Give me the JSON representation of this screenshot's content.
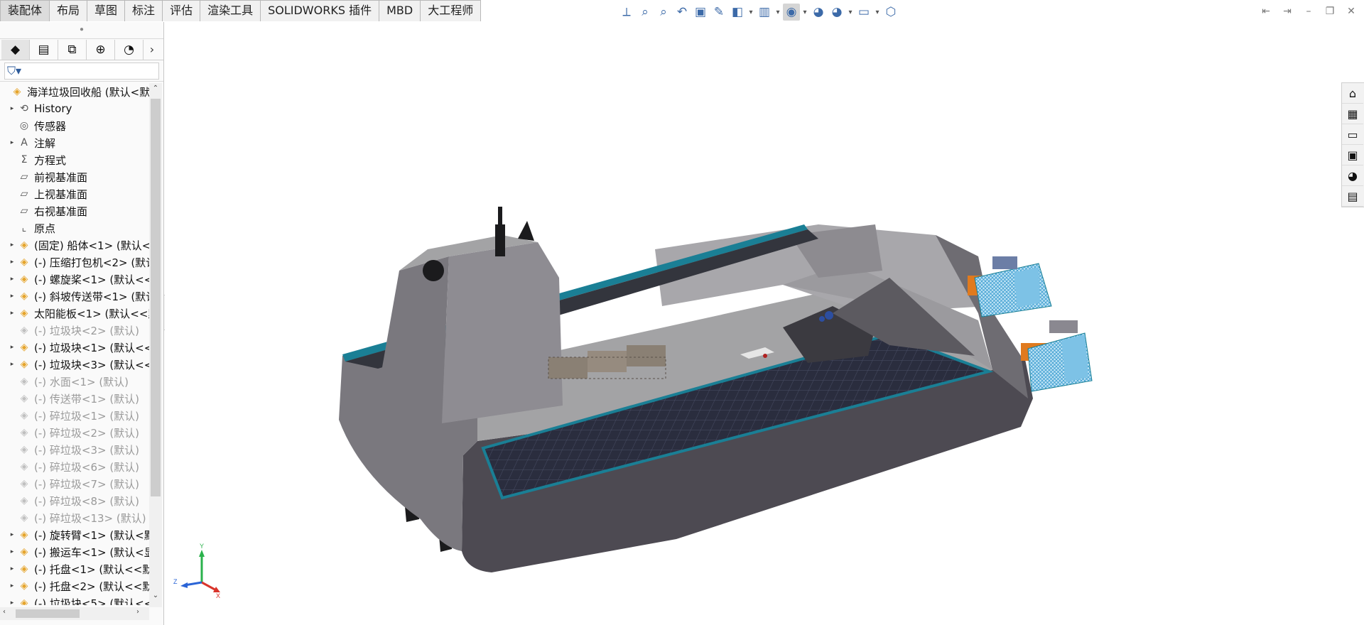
{
  "tabs": [
    {
      "label": "装配体",
      "active": true
    },
    {
      "label": "布局"
    },
    {
      "label": "草图"
    },
    {
      "label": "标注"
    },
    {
      "label": "评估"
    },
    {
      "label": "渲染工具"
    },
    {
      "label": "SOLIDWORKS 插件"
    },
    {
      "label": "MBD"
    },
    {
      "label": "大工程师"
    }
  ],
  "heads_up_toolbar": [
    {
      "icon": "view-orientation-icon",
      "glyph": "⟂"
    },
    {
      "icon": "zoom-to-fit-icon",
      "glyph": "⌕"
    },
    {
      "icon": "zoom-to-area-icon",
      "glyph": "⌕"
    },
    {
      "icon": "previous-view-icon",
      "glyph": "↶"
    },
    {
      "icon": "section-view-icon",
      "glyph": "▣"
    },
    {
      "icon": "dynamic-annotation-icon",
      "glyph": "✎"
    },
    {
      "icon": "display-style-icon",
      "glyph": "◧",
      "caret": true
    },
    {
      "icon": "view-cube-icon",
      "glyph": "▥",
      "caret": true
    },
    {
      "icon": "hide-show-icon",
      "glyph": "◉",
      "active": true,
      "caret": true
    },
    {
      "icon": "edit-appearance-icon",
      "glyph": "◕"
    },
    {
      "icon": "apply-scene-icon",
      "glyph": "◕",
      "caret": true
    },
    {
      "icon": "view-settings-icon",
      "glyph": "▭",
      "caret": true
    },
    {
      "icon": "isometric-cube-icon",
      "glyph": "⬡"
    }
  ],
  "panel_tabs": [
    {
      "icon": "featuremanager-icon",
      "glyph": "◆",
      "active": true
    },
    {
      "icon": "propertymanager-icon",
      "glyph": "▤"
    },
    {
      "icon": "configurationmanager-icon",
      "glyph": "⧉"
    },
    {
      "icon": "dimxpertmanager-icon",
      "glyph": "⊕"
    },
    {
      "icon": "displaymanager-icon",
      "glyph": "◔"
    }
  ],
  "tree": [
    {
      "label": "海洋垃圾回收船 (默认<默认",
      "icon": "assembly-icon",
      "glyph": "◈",
      "type": "root",
      "expander": ""
    },
    {
      "label": "History",
      "icon": "history-icon",
      "glyph": "⟲",
      "type": "folder",
      "expander": "▸"
    },
    {
      "label": "传感器",
      "icon": "sensor-icon",
      "glyph": "◎",
      "type": "folder",
      "expander": ""
    },
    {
      "label": "注解",
      "icon": "annotation-icon",
      "glyph": "A",
      "type": "folder",
      "expander": "▸"
    },
    {
      "label": "方程式",
      "icon": "equation-icon",
      "glyph": "Σ",
      "type": "folder",
      "expander": ""
    },
    {
      "label": "前视基准面",
      "icon": "plane-icon",
      "glyph": "▱",
      "type": "folder",
      "expander": ""
    },
    {
      "label": "上视基准面",
      "icon": "plane-icon",
      "glyph": "▱",
      "type": "folder",
      "expander": ""
    },
    {
      "label": "右视基准面",
      "icon": "plane-icon",
      "glyph": "▱",
      "type": "folder",
      "expander": ""
    },
    {
      "label": "原点",
      "icon": "origin-icon",
      "glyph": "⌞",
      "type": "folder",
      "expander": ""
    },
    {
      "label": "(固定) 船体<1> (默认<<",
      "icon": "part-icon",
      "glyph": "◈",
      "type": "part",
      "expander": "▸"
    },
    {
      "label": "(-) 压缩打包机<2> (默认",
      "icon": "part-icon",
      "glyph": "◈",
      "type": "part",
      "expander": "▸"
    },
    {
      "label": "(-) 螺旋桨<1> (默认<<",
      "icon": "part-icon",
      "glyph": "◈",
      "type": "part",
      "expander": "▸"
    },
    {
      "label": "(-) 斜坡传送带<1> (默认",
      "icon": "part-icon",
      "glyph": "◈",
      "type": "part",
      "expander": "▸"
    },
    {
      "label": "太阳能板<1> (默认<<默",
      "icon": "part-icon",
      "glyph": "◈",
      "type": "part",
      "expander": "▸"
    },
    {
      "label": "(-) 垃圾块<2> (默认)",
      "icon": "part-icon",
      "glyph": "◈",
      "type": "dim",
      "expander": ""
    },
    {
      "label": "(-) 垃圾块<1> (默认<<",
      "icon": "part-icon",
      "glyph": "◈",
      "type": "part",
      "expander": "▸"
    },
    {
      "label": "(-) 垃圾块<3> (默认<<",
      "icon": "part-icon",
      "glyph": "◈",
      "type": "part",
      "expander": "▸"
    },
    {
      "label": "(-) 水面<1> (默认)",
      "icon": "part-icon",
      "glyph": "◈",
      "type": "dim",
      "expander": ""
    },
    {
      "label": "(-) 传送带<1> (默认)",
      "icon": "part-icon",
      "glyph": "◈",
      "type": "dim",
      "expander": ""
    },
    {
      "label": "(-) 碎垃圾<1> (默认)",
      "icon": "part-icon",
      "glyph": "◈",
      "type": "dim",
      "expander": ""
    },
    {
      "label": "(-) 碎垃圾<2> (默认)",
      "icon": "part-icon",
      "glyph": "◈",
      "type": "dim",
      "expander": ""
    },
    {
      "label": "(-) 碎垃圾<3> (默认)",
      "icon": "part-icon",
      "glyph": "◈",
      "type": "dim",
      "expander": ""
    },
    {
      "label": "(-) 碎垃圾<6> (默认)",
      "icon": "part-icon",
      "glyph": "◈",
      "type": "dim",
      "expander": ""
    },
    {
      "label": "(-) 碎垃圾<7> (默认)",
      "icon": "part-icon",
      "glyph": "◈",
      "type": "dim",
      "expander": ""
    },
    {
      "label": "(-) 碎垃圾<8> (默认)",
      "icon": "part-icon",
      "glyph": "◈",
      "type": "dim",
      "expander": ""
    },
    {
      "label": "(-) 碎垃圾<13> (默认)",
      "icon": "part-icon",
      "glyph": "◈",
      "type": "dim",
      "expander": ""
    },
    {
      "label": "(-) 旋转臂<1> (默认<默",
      "icon": "subassembly-icon",
      "glyph": "◈",
      "type": "part",
      "expander": "▸"
    },
    {
      "label": "(-) 搬运车<1> (默认<显",
      "icon": "subassembly-icon",
      "glyph": "◈",
      "type": "part",
      "expander": "▸"
    },
    {
      "label": "(-) 托盘<1> (默认<<默",
      "icon": "part-icon",
      "glyph": "◈",
      "type": "part",
      "expander": "▸"
    },
    {
      "label": "(-) 托盘<2> (默认<<默",
      "icon": "part-icon",
      "glyph": "◈",
      "type": "part",
      "expander": "▸"
    },
    {
      "label": "(-) 垃圾块<5> (默认<<",
      "icon": "part-icon",
      "glyph": "◈",
      "type": "part",
      "expander": "▸"
    }
  ],
  "task_pane": [
    {
      "icon": "home-icon",
      "glyph": "⌂"
    },
    {
      "icon": "design-library-icon",
      "glyph": "▦"
    },
    {
      "icon": "file-explorer-icon",
      "glyph": "▭"
    },
    {
      "icon": "view-palette-icon",
      "glyph": "▣"
    },
    {
      "icon": "appearances-icon",
      "glyph": "◕"
    },
    {
      "icon": "custom-properties-icon",
      "glyph": "▤"
    }
  ],
  "triad": {
    "x": "X",
    "y": "Y",
    "z": "Z"
  },
  "colors": {
    "hull": "#8b8a8f",
    "deck": "#a3a3a5",
    "solar_panel": "#2a2d3e",
    "trim": "#1a7f95",
    "propeller_blue": "#4aaed8",
    "orange": "#e07a1e"
  }
}
